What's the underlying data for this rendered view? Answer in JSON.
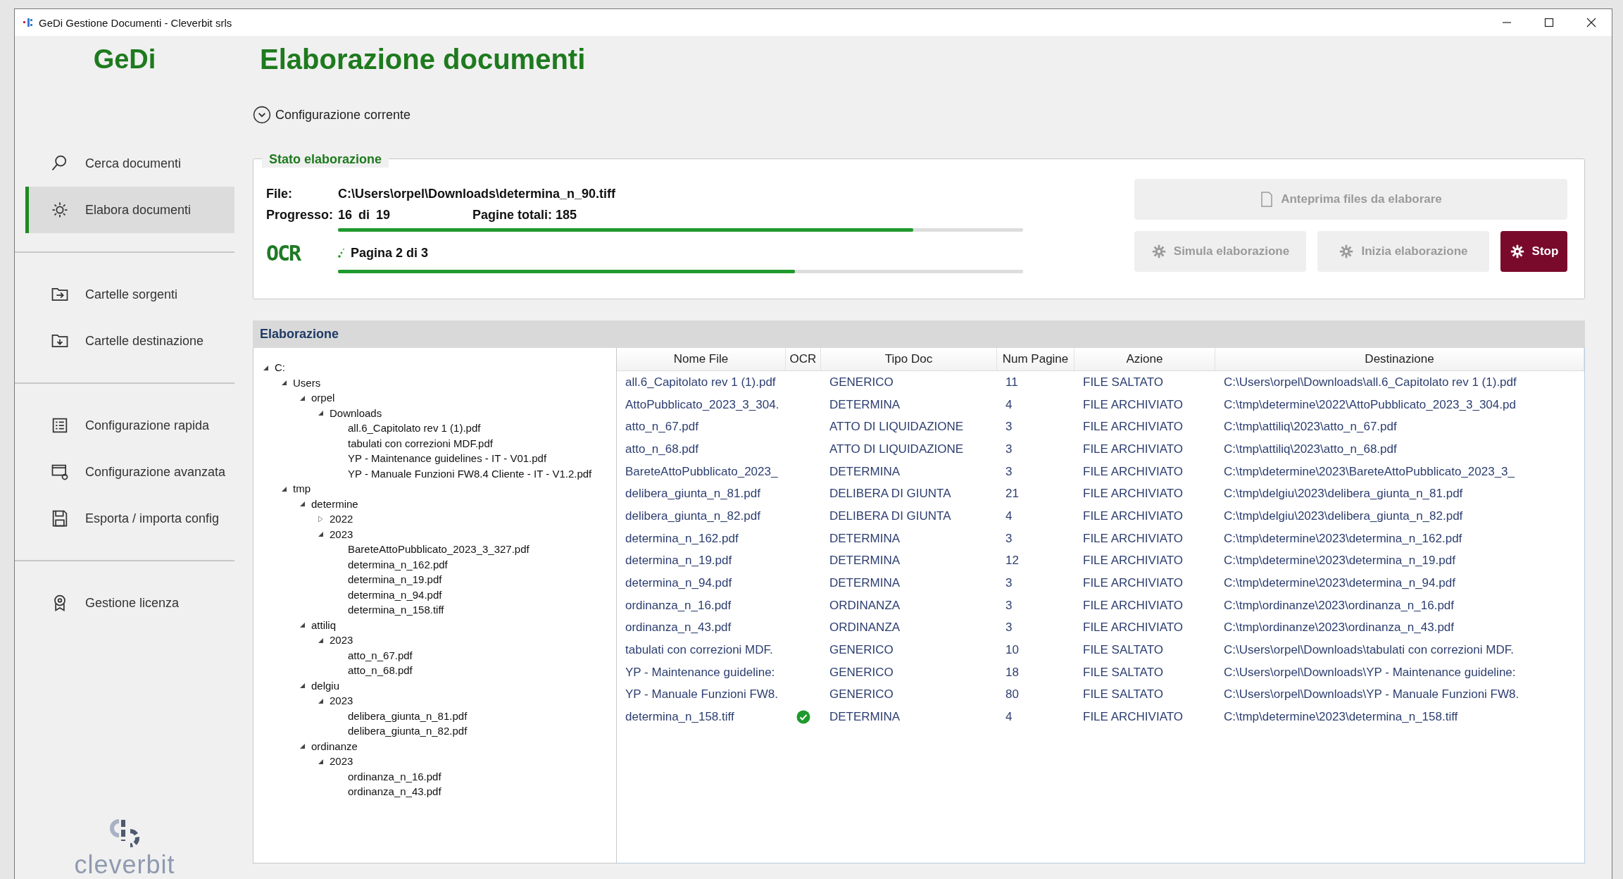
{
  "window": {
    "title": "GeDi Gestione Documenti - Cleverbit srls"
  },
  "sidebar": {
    "app_name": "GeDi",
    "groups": [
      [
        {
          "label": "Cerca documenti",
          "selected": false
        },
        {
          "label": "Elabora documenti",
          "selected": true
        }
      ],
      [
        {
          "label": "Cartelle sorgenti",
          "selected": false
        },
        {
          "label": "Cartelle destinazione",
          "selected": false
        }
      ],
      [
        {
          "label": "Configurazione rapida",
          "selected": false
        },
        {
          "label": "Configurazione avanzata",
          "selected": false
        },
        {
          "label": "Esporta / importa config",
          "selected": false
        }
      ],
      [
        {
          "label": "Gestione licenza",
          "selected": false
        }
      ]
    ],
    "logo": "cleverbit"
  },
  "page": {
    "title": "Elaborazione documenti",
    "config_toggle": "Configurazione corrente"
  },
  "status": {
    "legend": "Stato elaborazione",
    "file_label": "File:",
    "file_value": "C:\\Users\\orpel\\Downloads\\determina_n_90.tiff",
    "progress_label": "Progresso:",
    "progress_value": "16 di 19",
    "total_pages": "Pagine totali: 185",
    "progress": {
      "level": 0.84
    },
    "ocr_badge": "OCR",
    "page_progress_text": "Pagina 2 di 3",
    "page_progress": {
      "level": 0.667
    },
    "actions": [
      {
        "label": "Anteprima files da elaborare",
        "disabled": true
      },
      {
        "label": "Simula elaborazione",
        "disabled": true
      },
      {
        "label": "Inizia elaborazione",
        "disabled": true
      },
      {
        "label": "Stop",
        "disabled": false
      }
    ]
  },
  "processing": {
    "title": "Elaborazione",
    "tree": [
      {
        "label": "C:",
        "expanded": true,
        "children": [
          {
            "label": "Users",
            "expanded": true,
            "children": [
              {
                "label": "orpel",
                "expanded": true,
                "children": [
                  {
                    "label": "Downloads",
                    "expanded": true,
                    "children": [
                      {
                        "label": "all.6_Capitolato rev 1 (1).pdf"
                      },
                      {
                        "label": "tabulati con correzioni MDF.pdf"
                      },
                      {
                        "label": "YP - Maintenance guidelines - IT - V01.pdf"
                      },
                      {
                        "label": "YP - Manuale Funzioni FW8.4 Cliente - IT - V1.2.pdf"
                      }
                    ]
                  }
                ]
              }
            ]
          },
          {
            "label": "tmp",
            "expanded": true,
            "children": [
              {
                "label": "determine",
                "expanded": true,
                "children": [
                  {
                    "label": "2022",
                    "expanded": false
                  },
                  {
                    "label": "2023",
                    "expanded": true,
                    "children": [
                      {
                        "label": "BareteAttoPubblicato_2023_3_327.pdf"
                      },
                      {
                        "label": "determina_n_162.pdf"
                      },
                      {
                        "label": "determina_n_19.pdf"
                      },
                      {
                        "label": "determina_n_94.pdf"
                      },
                      {
                        "label": "determina_n_158.tiff"
                      }
                    ]
                  }
                ]
              },
              {
                "label": "attiliq",
                "expanded": true,
                "children": [
                  {
                    "label": "2023",
                    "expanded": true,
                    "children": [
                      {
                        "label": "atto_n_67.pdf"
                      },
                      {
                        "label": "atto_n_68.pdf"
                      }
                    ]
                  }
                ]
              },
              {
                "label": "delgiu",
                "expanded": true,
                "children": [
                  {
                    "label": "2023",
                    "expanded": true,
                    "children": [
                      {
                        "label": "delibera_giunta_n_81.pdf"
                      },
                      {
                        "label": "delibera_giunta_n_82.pdf"
                      }
                    ]
                  }
                ]
              },
              {
                "label": "ordinanze",
                "expanded": true,
                "children": [
                  {
                    "label": "2023",
                    "expanded": true,
                    "children": [
                      {
                        "label": "ordinanza_n_16.pdf"
                      },
                      {
                        "label": "ordinanza_n_43.pdf"
                      }
                    ]
                  }
                ]
              }
            ]
          }
        ]
      }
    ],
    "table": {
      "columns": [
        "Nome File",
        "OCR",
        "Tipo Doc",
        "Num Pagine",
        "Azione",
        "Destinazione"
      ],
      "rows": [
        {
          "name": "all.6_Capitolato rev 1 (1).pdf",
          "ocr": false,
          "doc_type": "GENERICO",
          "pages": "11",
          "action": "FILE SALTATO",
          "destination": "C:\\Users\\orpel\\Downloads\\all.6_Capitolato rev 1 (1).pdf"
        },
        {
          "name": "AttoPubblicato_2023_3_304.",
          "ocr": false,
          "doc_type": "DETERMINA",
          "pages": "4",
          "action": "FILE ARCHIVIATO",
          "destination": "C:\\tmp\\determine\\2022\\AttoPubblicato_2023_3_304.pd"
        },
        {
          "name": "atto_n_67.pdf",
          "ocr": false,
          "doc_type": "ATTO DI LIQUIDAZIONE",
          "pages": "3",
          "action": "FILE ARCHIVIATO",
          "destination": "C:\\tmp\\attiliq\\2023\\atto_n_67.pdf"
        },
        {
          "name": "atto_n_68.pdf",
          "ocr": false,
          "doc_type": "ATTO DI LIQUIDAZIONE",
          "pages": "3",
          "action": "FILE ARCHIVIATO",
          "destination": "C:\\tmp\\attiliq\\2023\\atto_n_68.pdf"
        },
        {
          "name": "BareteAttoPubblicato_2023_",
          "ocr": false,
          "doc_type": "DETERMINA",
          "pages": "3",
          "action": "FILE ARCHIVIATO",
          "destination": "C:\\tmp\\determine\\2023\\BareteAttoPubblicato_2023_3_"
        },
        {
          "name": "delibera_giunta_n_81.pdf",
          "ocr": false,
          "doc_type": "DELIBERA DI GIUNTA",
          "pages": "21",
          "action": "FILE ARCHIVIATO",
          "destination": "C:\\tmp\\delgiu\\2023\\delibera_giunta_n_81.pdf"
        },
        {
          "name": "delibera_giunta_n_82.pdf",
          "ocr": false,
          "doc_type": "DELIBERA DI GIUNTA",
          "pages": "4",
          "action": "FILE ARCHIVIATO",
          "destination": "C:\\tmp\\delgiu\\2023\\delibera_giunta_n_82.pdf"
        },
        {
          "name": "determina_n_162.pdf",
          "ocr": false,
          "doc_type": "DETERMINA",
          "pages": "3",
          "action": "FILE ARCHIVIATO",
          "destination": "C:\\tmp\\determine\\2023\\determina_n_162.pdf"
        },
        {
          "name": "determina_n_19.pdf",
          "ocr": false,
          "doc_type": "DETERMINA",
          "pages": "12",
          "action": "FILE ARCHIVIATO",
          "destination": "C:\\tmp\\determine\\2023\\determina_n_19.pdf"
        },
        {
          "name": "determina_n_94.pdf",
          "ocr": false,
          "doc_type": "DETERMINA",
          "pages": "3",
          "action": "FILE ARCHIVIATO",
          "destination": "C:\\tmp\\determine\\2023\\determina_n_94.pdf"
        },
        {
          "name": "ordinanza_n_16.pdf",
          "ocr": false,
          "doc_type": "ORDINANZA",
          "pages": "3",
          "action": "FILE ARCHIVIATO",
          "destination": "C:\\tmp\\ordinanze\\2023\\ordinanza_n_16.pdf"
        },
        {
          "name": "ordinanza_n_43.pdf",
          "ocr": false,
          "doc_type": "ORDINANZA",
          "pages": "3",
          "action": "FILE ARCHIVIATO",
          "destination": "C:\\tmp\\ordinanze\\2023\\ordinanza_n_43.pdf"
        },
        {
          "name": "tabulati con correzioni MDF.",
          "ocr": false,
          "doc_type": "GENERICO",
          "pages": "10",
          "action": "FILE SALTATO",
          "destination": "C:\\Users\\orpel\\Downloads\\tabulati con correzioni MDF."
        },
        {
          "name": "YP - Maintenance guideline:",
          "ocr": false,
          "doc_type": "GENERICO",
          "pages": "18",
          "action": "FILE SALTATO",
          "destination": "C:\\Users\\orpel\\Downloads\\YP - Maintenance guideline:"
        },
        {
          "name": "YP - Manuale Funzioni FW8.",
          "ocr": false,
          "doc_type": "GENERICO",
          "pages": "80",
          "action": "FILE SALTATO",
          "destination": "C:\\Users\\orpel\\Downloads\\YP - Manuale Funzioni FW8."
        },
        {
          "name": "determina_n_158.tiff",
          "ocr": true,
          "doc_type": "DETERMINA",
          "pages": "4",
          "action": "FILE ARCHIVIATO",
          "destination": "C:\\tmp\\determine\\2023\\determina_n_158.tiff"
        }
      ]
    }
  }
}
